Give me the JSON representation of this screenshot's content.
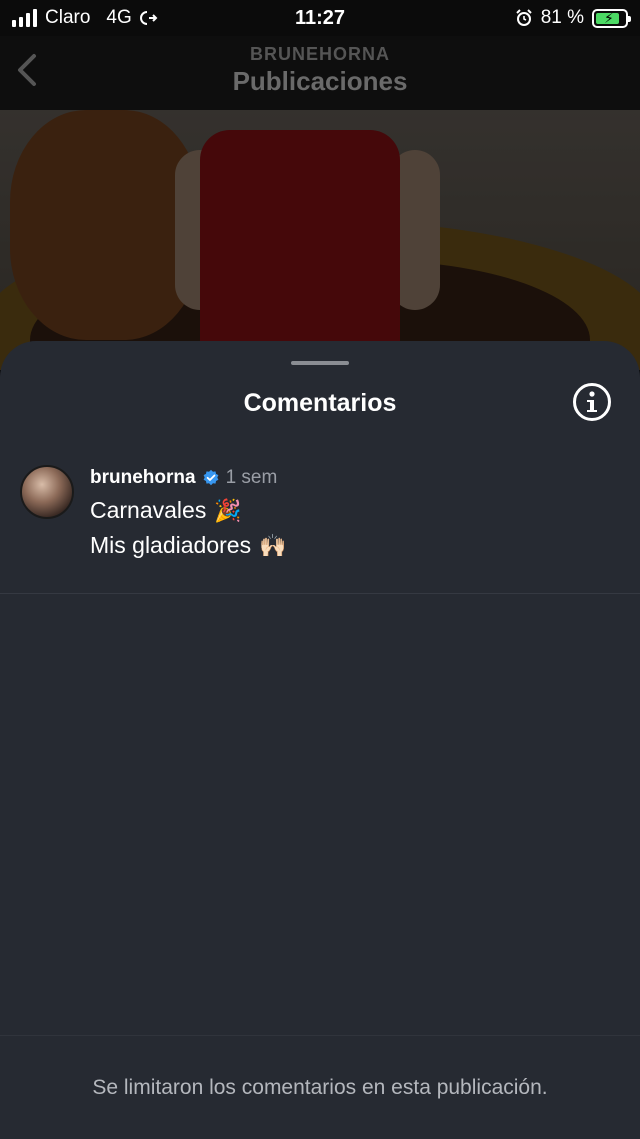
{
  "status_bar": {
    "carrier": "Claro",
    "network": "4G",
    "time": "11:27",
    "battery_percent": "81 %",
    "battery_level": 0.81,
    "battery_color": "#4cd964"
  },
  "header": {
    "username": "BRUNEHORNA",
    "title": "Publicaciones",
    "back_icon": "chevron-left-icon"
  },
  "comments_sheet": {
    "title": "Comentarios",
    "info_icon": "info-icon",
    "comment": {
      "username": "brunehorna",
      "verified": true,
      "time": "1 sem",
      "line1": "Carnavales",
      "line1_emoji": "🎉",
      "line2": "Mis gladiadores",
      "line2_emoji": "🙌🏻"
    },
    "footer": "Se limitaron los comentarios en esta publicación."
  },
  "colors": {
    "sheet_bg": "#262a32",
    "verified_blue": "#3897f0"
  }
}
